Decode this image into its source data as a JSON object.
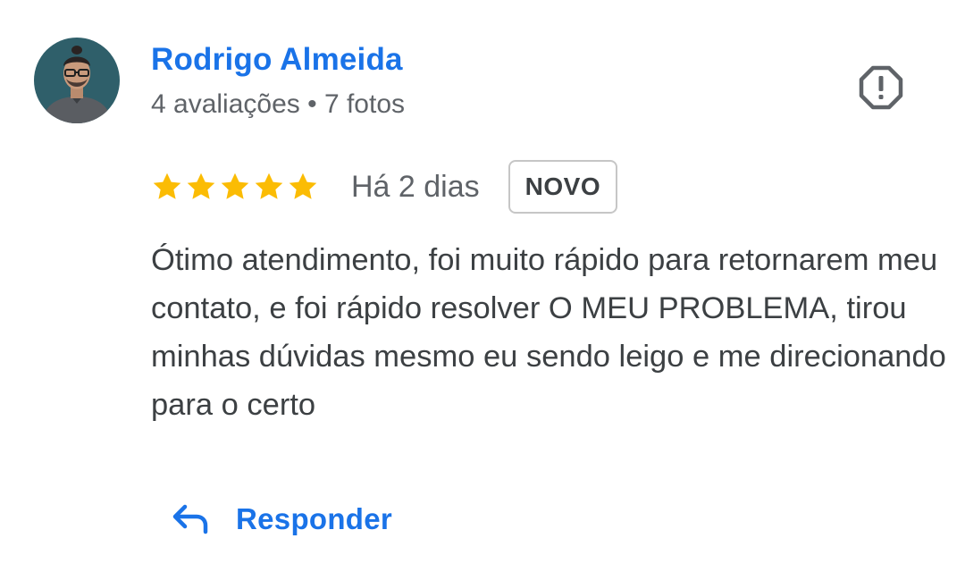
{
  "reviewer": {
    "name": "Rodrigo Almeida",
    "meta": "4 avaliações • 7 fotos",
    "avatar_icon": "user-photo"
  },
  "report_icon": "report-octagon-icon",
  "review": {
    "rating": 5,
    "max_rating": 5,
    "star_color": "#fbbc04",
    "date": "Há 2 dias",
    "badge": "NOVO",
    "text": "Ótimo atendimento, foi muito rápido para retornarem meu contato, e foi rápido resolver O MEU PROBLEMA, tirou minhas dúvidas mesmo eu sendo leigo e me direcionando para o certo"
  },
  "actions": {
    "reply_label": "Responder",
    "reply_icon": "reply-arrow-icon"
  },
  "colors": {
    "accent": "#1a73e8",
    "text": "#3c4043",
    "secondary_text": "#5f6368"
  }
}
